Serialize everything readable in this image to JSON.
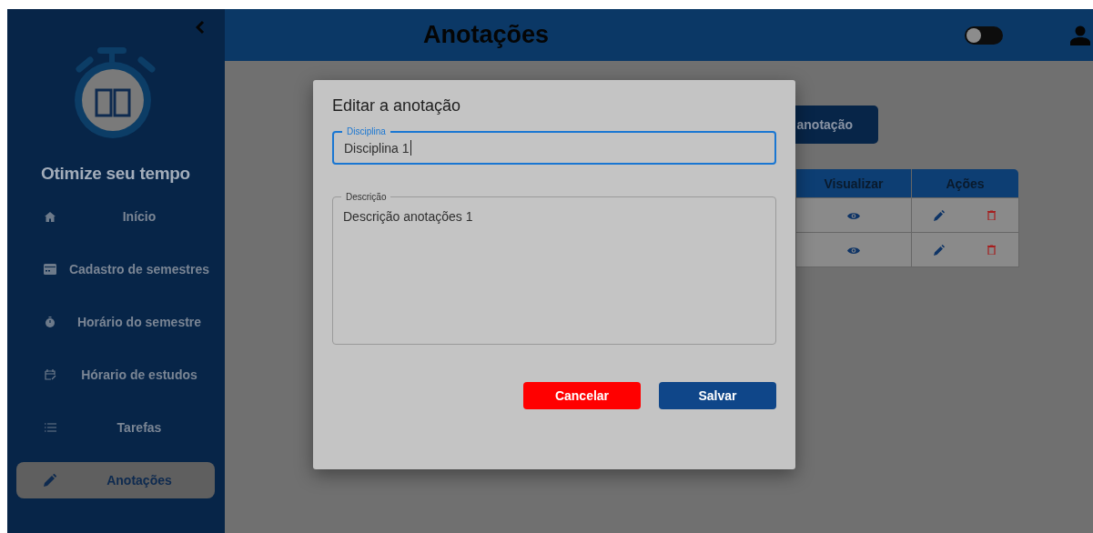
{
  "sidebar": {
    "brand": "Otimize seu tempo",
    "items": [
      {
        "label": "Início",
        "kind": "home",
        "selected": false
      },
      {
        "label": "Cadastro de semestres",
        "kind": "card",
        "selected": false
      },
      {
        "label": "Horário do semestre",
        "kind": "timer",
        "selected": false
      },
      {
        "label": "Hórario de estudos",
        "kind": "calendar",
        "selected": false
      },
      {
        "label": "Tarefas",
        "kind": "list",
        "selected": false
      },
      {
        "label": "Anotações",
        "kind": "pencil",
        "selected": true
      }
    ]
  },
  "header": {
    "title": "Anotações",
    "theme_toggle": {
      "on": false
    }
  },
  "main": {
    "new_button": "anotação",
    "table": {
      "columns": [
        "Visualizar",
        "Ações"
      ],
      "rows": [
        {
          "kind": "note"
        },
        {
          "kind": "note"
        }
      ]
    }
  },
  "dialog": {
    "title": "Editar a anotação",
    "fields": [
      {
        "label": "Disciplina",
        "value": "Disciplina 1",
        "kind": "input",
        "focused": true
      },
      {
        "label": "Descrição",
        "value": "Descrição anotações 1",
        "kind": "textarea",
        "focused": false
      }
    ],
    "buttons": [
      {
        "label": "Cancelar",
        "kind": "cancel"
      },
      {
        "label": "Salvar",
        "kind": "primary"
      }
    ]
  }
}
